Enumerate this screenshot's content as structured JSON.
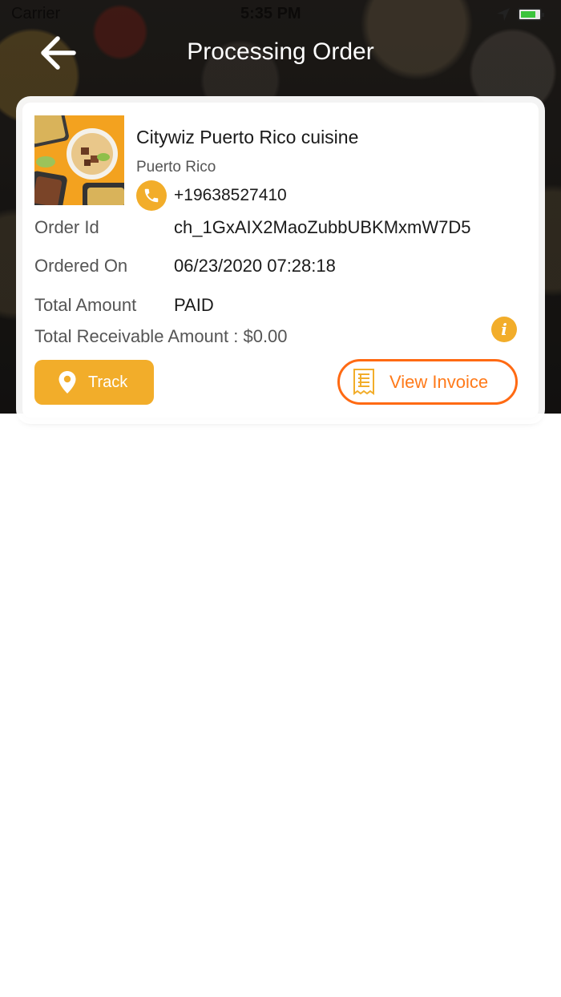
{
  "status_bar": {
    "carrier": "Carrier",
    "time": "5:35 PM"
  },
  "header": {
    "title": "Processing Order"
  },
  "order": {
    "restaurant_name": "Citywiz Puerto Rico cuisine",
    "restaurant_location": "Puerto Rico",
    "phone": "+19638527410",
    "rows": [
      {
        "label": "Order Id",
        "value": "ch_1GxAIX2MaoZubbUBKMxmW7D5"
      },
      {
        "label": "Ordered On",
        "value": "06/23/2020 07:28:18"
      },
      {
        "label": "Total Amount",
        "value": "PAID"
      }
    ],
    "receivable": "Total Receivable Amount : $0.00",
    "track_label": "Track",
    "invoice_label": "View Invoice"
  },
  "colors": {
    "accent": "#f2ad2a",
    "invoice_orange": "#ff6a13"
  },
  "icons": [
    "back-arrow-icon",
    "phone-icon",
    "info-icon",
    "location-pin-icon",
    "receipt-icon",
    "location-arrow-icon",
    "battery-icon",
    "wifi-icon"
  ]
}
